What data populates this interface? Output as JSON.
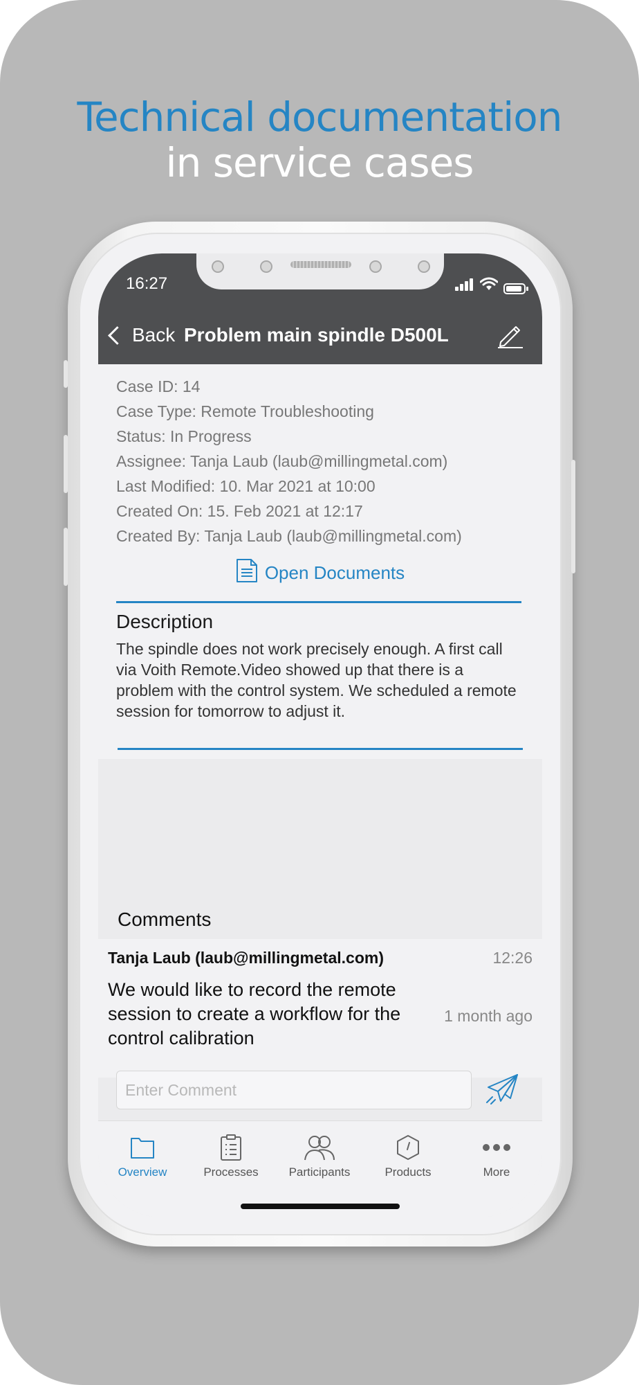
{
  "headline": {
    "line1": "Technical documentation",
    "line2": "in service cases"
  },
  "status_bar": {
    "time": "16:27",
    "icons": [
      "signal-icon",
      "wifi-icon",
      "battery-icon"
    ]
  },
  "nav": {
    "back_label": "Back",
    "title": "Problem main spindle D500L",
    "edit_icon": "pencil-icon"
  },
  "case": {
    "meta": [
      "Case ID: 14",
      "Case Type: Remote Troubleshooting",
      "Status: In Progress",
      "Assignee: Tanja Laub (laub@millingmetal.com)",
      "Last Modified: 10. Mar 2021 at 10:00",
      "Created On: 15. Feb 2021 at 12:17",
      "Created By: Tanja Laub (laub@millingmetal.com)"
    ],
    "open_documents_label": "Open Documents"
  },
  "description": {
    "heading": "Description",
    "text": "The spindle does not work precisely enough. A first call via Voith Remote.Video showed up that there is a problem with the control system. We scheduled a remote session for tomorrow to adjust it."
  },
  "comments": {
    "heading": "Comments",
    "items": [
      {
        "author": "Tanja Laub (laub@millingmetal.com)",
        "time": "12:26",
        "text": "We would like to record the remote session to create a workflow for the control calibration",
        "ago": "1 month ago"
      }
    ],
    "input_placeholder": "Enter Comment"
  },
  "tabs": [
    {
      "label": "Overview",
      "icon": "folder-icon",
      "active": true
    },
    {
      "label": "Processes",
      "icon": "clipboard-icon",
      "active": false
    },
    {
      "label": "Participants",
      "icon": "people-icon",
      "active": false
    },
    {
      "label": "Products",
      "icon": "hexagon-icon",
      "active": false
    },
    {
      "label": "More",
      "icon": "more-icon",
      "active": false
    }
  ],
  "colors": {
    "accent": "#2585c4",
    "nav_bar": "#4e4f51",
    "background": "#b8b8b8"
  }
}
